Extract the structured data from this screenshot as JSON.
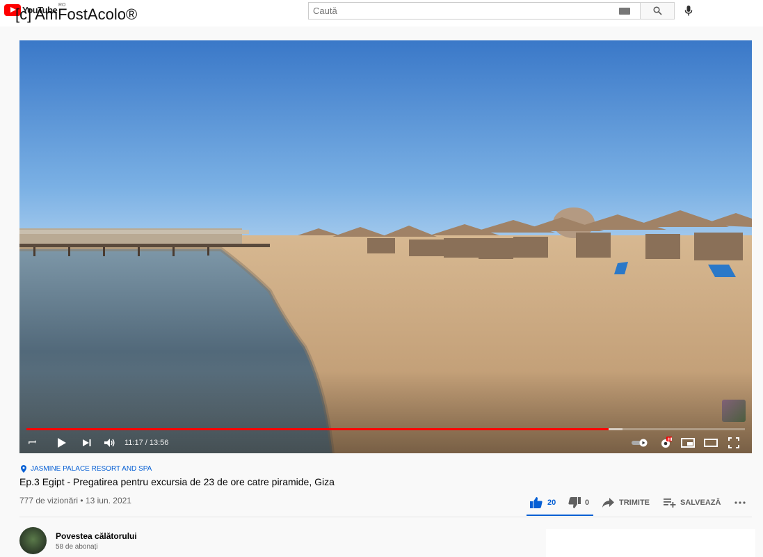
{
  "watermark": "[c] AmFostAcolo®",
  "header": {
    "logo_text": "YouTube",
    "country": "RO",
    "search_placeholder": "Caută"
  },
  "player": {
    "time": "11:17 / 13:56",
    "progress": 0.81,
    "buffered": 0.83,
    "hd_badge": "HD"
  },
  "video": {
    "location": "JASMINE PALACE RESORT AND SPA",
    "title": "Ep.3 Egipt - Pregatirea pentru excursia de 23 de ore catre piramide, Giza",
    "meta": "777 de vizionări • 13 iun. 2021"
  },
  "actions": {
    "likes": "20",
    "dislikes": "0",
    "share": "TRIMITE",
    "save": "SALVEAZĂ"
  },
  "channel": {
    "name": "Povestea călătorului",
    "subscribers": "58 de abonați"
  },
  "colors": {
    "accent": "#065fd4",
    "progress": "#ff0000",
    "sky_top": "#3d7bc9",
    "sand": "#c9a57a"
  }
}
